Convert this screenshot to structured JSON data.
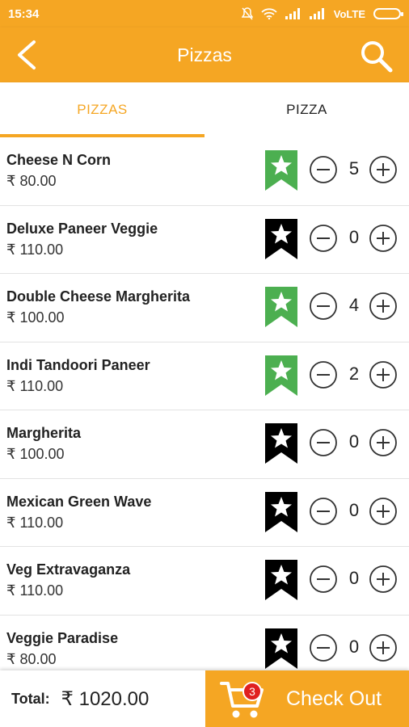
{
  "status_bar": {
    "time": "15:34",
    "network": "VoLTE"
  },
  "app_bar": {
    "title": "Pizzas"
  },
  "tabs": [
    {
      "label": "PIZZAS",
      "active": true
    },
    {
      "label": "PIZZA",
      "active": false
    }
  ],
  "items": [
    {
      "name": "Cheese N Corn",
      "price": "₹ 80.00",
      "qty": "5",
      "bookmarked": true
    },
    {
      "name": "Deluxe Paneer Veggie",
      "price": "₹ 110.00",
      "qty": "0",
      "bookmarked": false
    },
    {
      "name": "Double Cheese Margherita",
      "price": "₹ 100.00",
      "qty": "4",
      "bookmarked": true
    },
    {
      "name": "Indi Tandoori Paneer",
      "price": "₹ 110.00",
      "qty": "2",
      "bookmarked": true
    },
    {
      "name": "Margherita",
      "price": "₹ 100.00",
      "qty": "0",
      "bookmarked": false
    },
    {
      "name": "Mexican Green Wave",
      "price": "₹ 110.00",
      "qty": "0",
      "bookmarked": false
    },
    {
      "name": "Veg Extravaganza",
      "price": "₹ 110.00",
      "qty": "0",
      "bookmarked": false
    },
    {
      "name": "Veggie Paradise",
      "price": "₹ 80.00",
      "qty": "0",
      "bookmarked": false
    }
  ],
  "footer": {
    "total_label": "Total:",
    "total_value": "₹ 1020.00",
    "cart_count": "3",
    "checkout_label": "Check Out"
  },
  "colors": {
    "accent": "#f5a623",
    "bookmark_active": "#4caf50",
    "bookmark_inactive": "#000000",
    "badge": "#e02020"
  },
  "icons": {
    "back": "back-arrow-icon",
    "search": "search-icon",
    "bookmark": "bookmark-star-icon",
    "minus": "minus-circle-icon",
    "plus": "plus-circle-icon",
    "cart": "shopping-cart-icon"
  }
}
